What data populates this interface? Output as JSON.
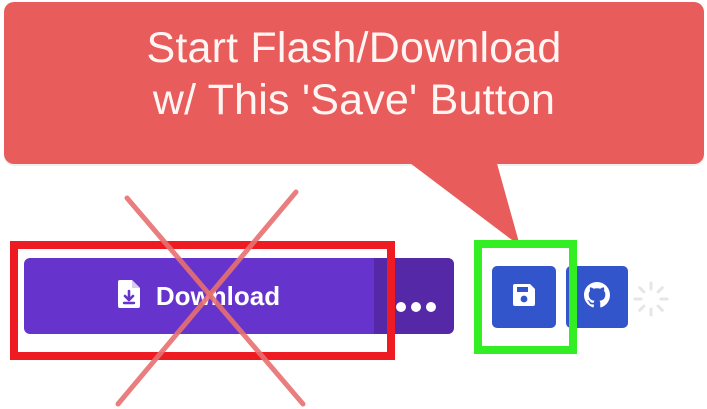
{
  "callout": {
    "line1": "Start Flash/Download",
    "line2": "w/ This 'Save' Button",
    "color": "#e85c5c"
  },
  "toolbar": {
    "download_label": "Download",
    "download_icon": "file-download-icon",
    "more_icon": "ellipsis-icon",
    "save_icon": "floppy-disk-icon",
    "github_icon": "github-icon",
    "loading_icon": "spinner-icon"
  },
  "annotations": {
    "red_frame_color": "#ee1c22",
    "green_frame_color": "#33ee22",
    "cross_color": "#e87070"
  },
  "colors": {
    "download_button": "#6633cc",
    "more_button": "#5528a8",
    "blue_buttons": "#3355cc"
  }
}
